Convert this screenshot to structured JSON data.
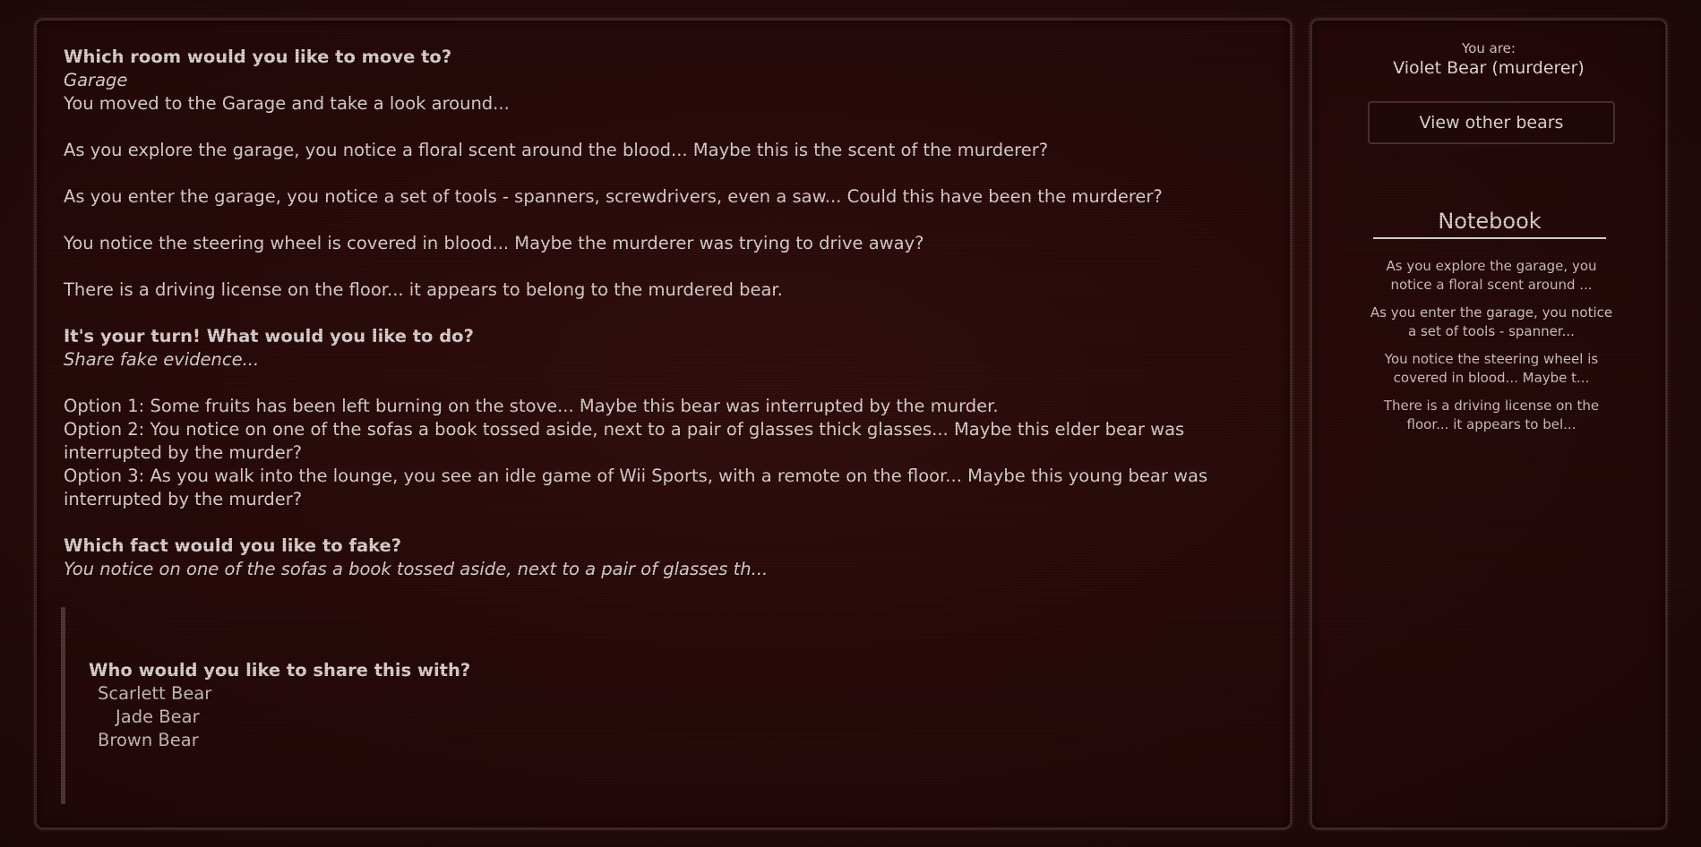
{
  "main": {
    "q_room": "Which room would you like to move to?",
    "a_room": "Garage",
    "moved": "You moved to the Garage and take a look around...",
    "clue1": "As you explore the garage, you notice a floral scent around the blood... Maybe this is the scent of the murderer?",
    "clue2": "As you enter the garage, you notice a set of tools - spanners, screwdrivers, even a saw... Could this have been the murderer?",
    "clue3": "You notice the steering wheel is covered in blood... Maybe the murderer was trying to drive away?",
    "clue4": "There is a driving license on the floor... it appears to belong to the murdered bear.",
    "q_turn": "It's your turn! What would you like to do?",
    "a_turn": "Share fake evidence...",
    "option1": "Option 1: Some fruits has been left burning on the stove... Maybe this bear was interrupted by the murder.",
    "option2a": "Option 2: You notice on one of the sofas a book tossed aside, next to a pair of glasses thick glasses... Maybe this elder bear was",
    "option2b": "interrupted by the murder?",
    "option3a": "Option 3: As you walk into the lounge, you see an idle game of Wii Sports, with a remote on the floor... Maybe this young bear was",
    "option3b": "interrupted by the murder?",
    "q_fake": "Which fact would you like to fake?",
    "a_fake": "You notice on one of the sofas a book tossed aside, next to a pair of glasses th..."
  },
  "share": {
    "question": "Who would you like to share this with?",
    "bears": [
      "Scarlett Bear",
      "Jade Bear",
      "Brown Bear"
    ]
  },
  "sidebar": {
    "you_are_label": "You are:",
    "identity": "Violet Bear (murderer)",
    "view_button": "View other bears",
    "notebook_title": "Notebook",
    "notes": [
      "As you explore the garage, you notice a floral scent around ...",
      "As you enter the garage, you notice a set of tools - spanner...",
      "You notice the steering wheel is covered in blood... Maybe t...",
      "There is a driving license on the floor... it appears to bel..."
    ]
  },
  "colors": {
    "background": "#2a0c0c",
    "text": "#e4dada",
    "border": "#7a5a5a"
  }
}
